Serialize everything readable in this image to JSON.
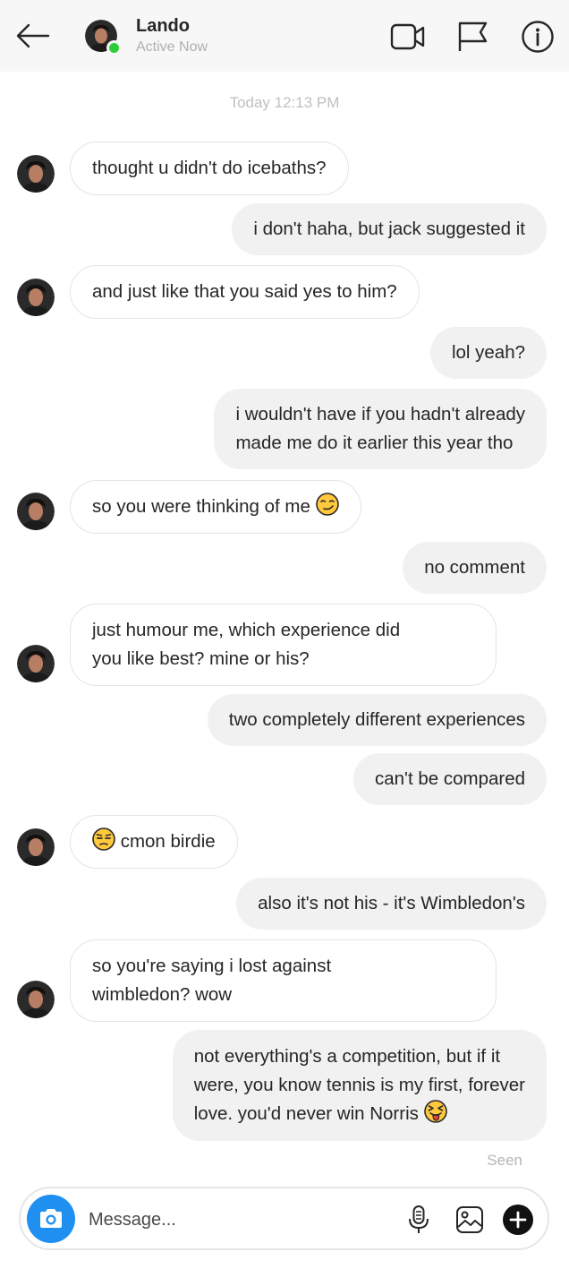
{
  "header": {
    "name": "Lando",
    "status": "Active Now",
    "icons": [
      "back-arrow-icon",
      "video-call-icon",
      "flag-icon",
      "info-icon"
    ],
    "online_color": "#2ccf3a"
  },
  "thread": {
    "timestamp": "Today 12:13 PM",
    "messages": [
      {
        "from": "them",
        "text": "thought u didn't do icebaths?"
      },
      {
        "from": "me",
        "text": "i don't haha, but jack suggested it"
      },
      {
        "from": "them",
        "text": "and just like that you said yes to him?"
      },
      {
        "from": "me",
        "text": "lol yeah?"
      },
      {
        "from": "me",
        "line1": "i wouldn't have if you hadn't already",
        "line2": "made me do it earlier this year tho"
      },
      {
        "from": "them",
        "text": "so you were thinking of me",
        "emoji": "smirking-face-emoji"
      },
      {
        "from": "me",
        "text": "no comment"
      },
      {
        "from": "them",
        "line1": "just humour me, which experience did",
        "line2": "you like best? mine or his?"
      },
      {
        "from": "me",
        "text": "two completely different experiences"
      },
      {
        "from": "me",
        "text": "can't be compared"
      },
      {
        "from": "them",
        "text": "cmon birdie",
        "emoji": "unamused-face-emoji"
      },
      {
        "from": "me",
        "text": "also it's not his - it's Wimbledon's"
      },
      {
        "from": "them",
        "line1": "so you're saying i lost against",
        "line2": "wimbledon? wow"
      },
      {
        "from": "me",
        "line1": "not everything's a competition, but if it",
        "line2": "were, you know tennis is my first, forever",
        "line3": "love. you'd never win Norris",
        "emoji": "squinting-face-with-tongue-emoji"
      }
    ],
    "seen": "Seen"
  },
  "composer": {
    "placeholder": "Message...",
    "icons": [
      "camera-icon",
      "microphone-icon",
      "image-icon",
      "add-icon"
    ],
    "camera_color": "#1f8ff0"
  }
}
